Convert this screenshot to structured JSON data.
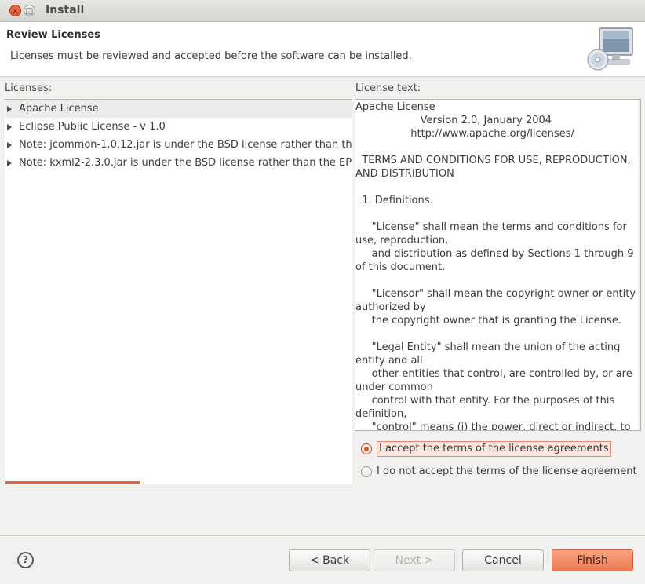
{
  "window": {
    "title": "Install",
    "close_glyph": "×",
    "maximize_glyph": "□"
  },
  "header": {
    "title": "Review Licenses",
    "subtitle": "Licenses must be reviewed and accepted before the software can be installed.",
    "icon": "computer-cd-icon"
  },
  "licenses": {
    "label": "Licenses:",
    "items": [
      {
        "label": "Apache License",
        "selected": true
      },
      {
        "label": "Eclipse Public License - v 1.0",
        "selected": false
      },
      {
        "label": "Note:  jcommon-1.0.12.jar is under the BSD license rather than th",
        "selected": false
      },
      {
        "label": "Note:  kxml2-2.3.0.jar is under the BSD license rather than the EP",
        "selected": false
      }
    ],
    "progress_fraction": 0.39
  },
  "license_text": {
    "label": "License text:",
    "lines": [
      "Apache License",
      "                    Version 2.0, January 2004",
      "                 http://www.apache.org/licenses/",
      "",
      "  TERMS AND CONDITIONS FOR USE, REPRODUCTION,",
      "AND DISTRIBUTION",
      "",
      "  1. Definitions.",
      "",
      "     \"License\" shall mean the terms and conditions for",
      "use, reproduction,",
      "     and distribution as defined by Sections 1 through 9",
      "of this document.",
      "",
      "     \"Licensor\" shall mean the copyright owner or entity",
      "authorized by",
      "     the copyright owner that is granting the License.",
      "",
      "     \"Legal Entity\" shall mean the union of the acting",
      "entity and all",
      "     other entities that control, are controlled by, or are",
      "under common",
      "     control with that entity. For the purposes of this",
      "definition,",
      "     \"control\" means (i) the power, direct or indirect, to"
    ]
  },
  "agreement": {
    "accept_label": "I accept the terms of the license agreements",
    "decline_label": "I do not accept the terms of the license agreement",
    "accepted": true
  },
  "buttons": {
    "help_glyph": "?",
    "back": "< Back",
    "next": "Next >",
    "cancel": "Cancel",
    "finish": "Finish"
  },
  "colors": {
    "accent": "#e8633d",
    "primary_button": "#ef8a62"
  }
}
